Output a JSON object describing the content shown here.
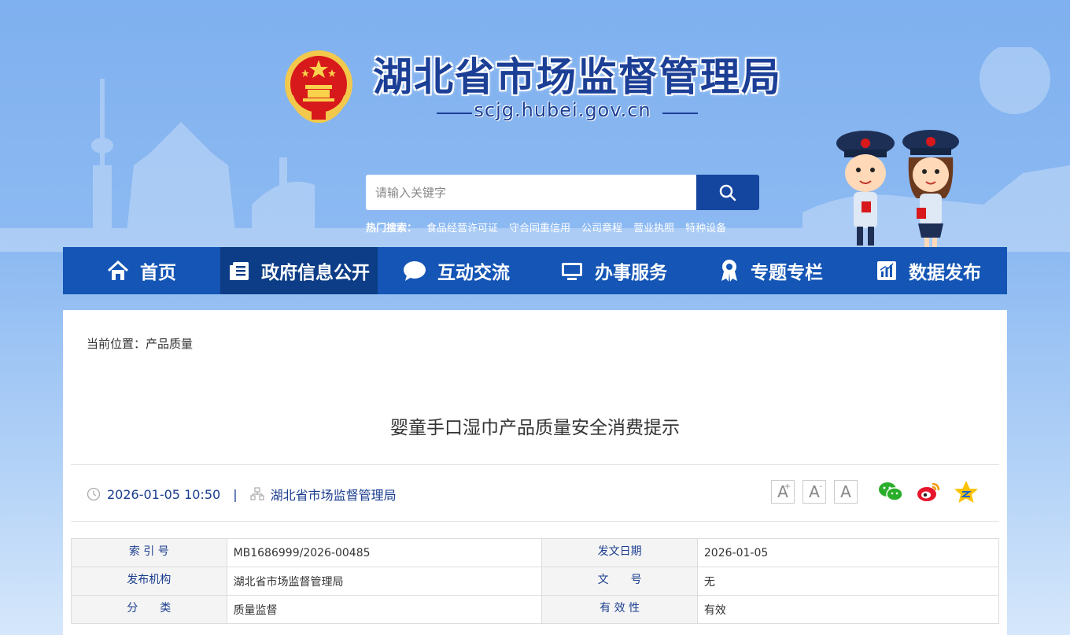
{
  "header": {
    "title": "湖北省市场监督管理局",
    "domain": "scjg.hubei.gov.cn",
    "search_placeholder": "请输入关键字",
    "hot_label": "热门搜索：",
    "hot_items": [
      "食品经营许可证",
      "守合同重信用",
      "公司章程",
      "营业执照",
      "特种设备"
    ]
  },
  "nav": {
    "items": [
      {
        "label": "首页",
        "icon": "home-icon"
      },
      {
        "label": "政府信息公开",
        "icon": "document-list-icon"
      },
      {
        "label": "互动交流",
        "icon": "chat-bubble-icon"
      },
      {
        "label": "办事服务",
        "icon": "monitor-icon"
      },
      {
        "label": "专题专栏",
        "icon": "badge-icon"
      },
      {
        "label": "数据发布",
        "icon": "chart-icon"
      }
    ],
    "active": "政府信息公开"
  },
  "article": {
    "breadcrumb": "当前位置：产品质量",
    "title": "婴童手口湿巾产品质量安全消费提示",
    "datetime": "2026-01-05 10:50",
    "separator": "|",
    "publisher": "湖北省市场监督管理局"
  },
  "font_sizes": [
    "A",
    "A",
    "A"
  ],
  "font_size_marks": [
    "+",
    "-"
  ],
  "share": [
    "wechat-icon",
    "weibo-icon",
    "qzone-icon"
  ],
  "info_table": {
    "rows": [
      {
        "k1": "索 引 号",
        "v1": "MB1686999/2026-00485",
        "k2": "发文日期",
        "v2": "2026-01-05"
      },
      {
        "k1": "发布机构",
        "v1": "湖北省市场监督管理局",
        "k2": "文　　号",
        "v2": "无"
      },
      {
        "k1": "分　　类",
        "v1": "质量监督",
        "k2": "有 效 性",
        "v2": "有效"
      }
    ]
  },
  "colors": {
    "nav_bg": "#1455b5",
    "nav_active": "#0d3d86",
    "title_color": "#1c3f96",
    "accent": "#1446a0"
  }
}
